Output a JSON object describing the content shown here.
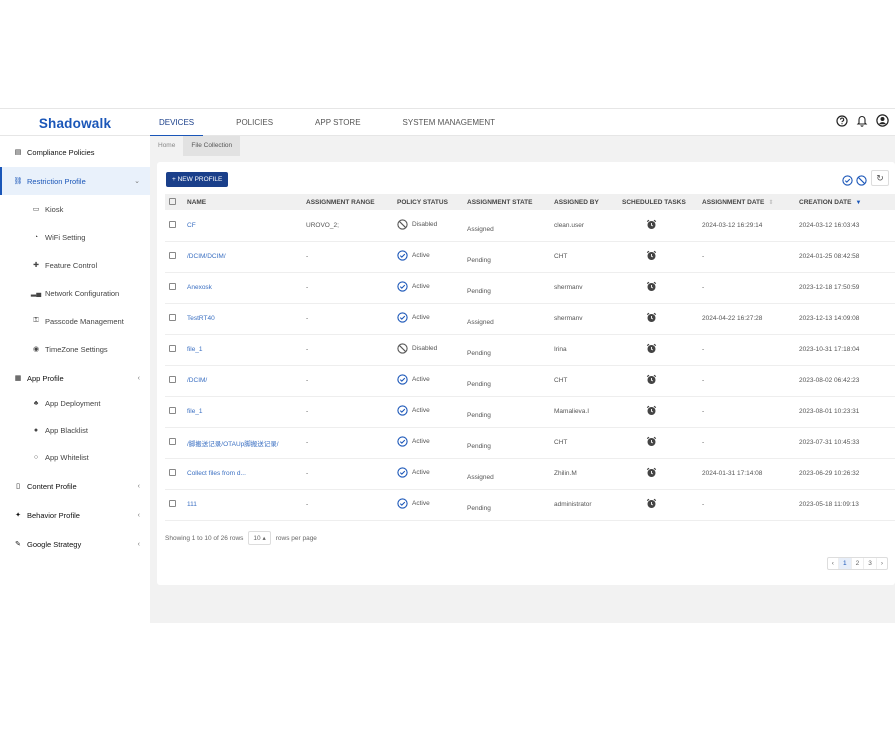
{
  "brand": "Shadowalk",
  "nav": [
    "DEVICES",
    "POLICIES",
    "APP STORE",
    "SYSTEM MANAGEMENT"
  ],
  "sidebar": {
    "compliance": "Compliance Policies",
    "restriction": "Restriction Profile",
    "restriction_items": [
      "Kiosk",
      "WiFi Setting",
      "Feature Control",
      "Network Configuration",
      "Passcode Management",
      "TimeZone Settings"
    ],
    "app_profile": "App Profile",
    "app_items": [
      "App Deployment",
      "App Blacklist",
      "App Whitelist"
    ],
    "content": "Content Profile",
    "behavior": "Behavior Profile",
    "google": "Google Strategy"
  },
  "breadcrumb": [
    "Home",
    "File Collection"
  ],
  "new_button": "+ NEW PROFILE",
  "columns": [
    "NAME",
    "ASSIGNMENT RANGE",
    "POLICY STATUS",
    "ASSIGNMENT STATE",
    "ASSIGNED BY",
    "SCHEDULED TASKS",
    "ASSIGNMENT DATE",
    "CREATION DATE"
  ],
  "rows": [
    {
      "name": "CF",
      "range": "UROVO_2;",
      "status": "Disabled",
      "state": "Assigned",
      "by": "clean.user",
      "adate": "2024-03-12 16:29:14",
      "cdate": "2024-03-12 16:03:43"
    },
    {
      "name": "/DCIM/DCIM/",
      "range": "-",
      "status": "Active",
      "state": "Pending",
      "by": "CHT",
      "adate": "-",
      "cdate": "2024-01-25 08:42:58"
    },
    {
      "name": "Anexosk",
      "range": "-",
      "status": "Active",
      "state": "Pending",
      "by": "shermanv",
      "adate": "-",
      "cdate": "2023-12-18 17:50:59"
    },
    {
      "name": "TestRT40",
      "range": "-",
      "status": "Active",
      "state": "Assigned",
      "by": "shermanv",
      "adate": "2024-04-22 16:27:28",
      "cdate": "2023-12-13 14:09:08"
    },
    {
      "name": "file_1",
      "range": "-",
      "status": "Disabled",
      "state": "Pending",
      "by": "Irina",
      "adate": "-",
      "cdate": "2023-10-31 17:18:04"
    },
    {
      "name": "/DCIM/",
      "range": "-",
      "status": "Active",
      "state": "Pending",
      "by": "CHT",
      "adate": "-",
      "cdate": "2023-08-02 06:42:23"
    },
    {
      "name": "file_1",
      "range": "-",
      "status": "Active",
      "state": "Pending",
      "by": "Mamalieva.I",
      "adate": "-",
      "cdate": "2023-08-01 10:23:31"
    },
    {
      "name": "/脚搬送记录/OTAUp脚搬送记录/",
      "range": "-",
      "status": "Active",
      "state": "Pending",
      "by": "CHT",
      "adate": "-",
      "cdate": "2023-07-31 10:45:33"
    },
    {
      "name": "Collect files from d...",
      "range": "-",
      "status": "Active",
      "state": "Assigned",
      "by": "Zhilin.M",
      "adate": "2024-01-31 17:14:08",
      "cdate": "2023-06-29 10:26:32"
    },
    {
      "name": "111",
      "range": "-",
      "status": "Active",
      "state": "Pending",
      "by": "administrator",
      "adate": "-",
      "cdate": "2023-05-18 11:09:13"
    }
  ],
  "footer": {
    "showing": "Showing 1 to 10 of 26 rows",
    "rpp": "10 ▴",
    "rpp_label": "rows per page"
  },
  "pager": [
    "‹",
    "1",
    "2",
    "3",
    "›"
  ],
  "colors": {
    "accent": "#1a56b8",
    "dark": "#1a3f8a",
    "link": "#3a6fc2"
  }
}
